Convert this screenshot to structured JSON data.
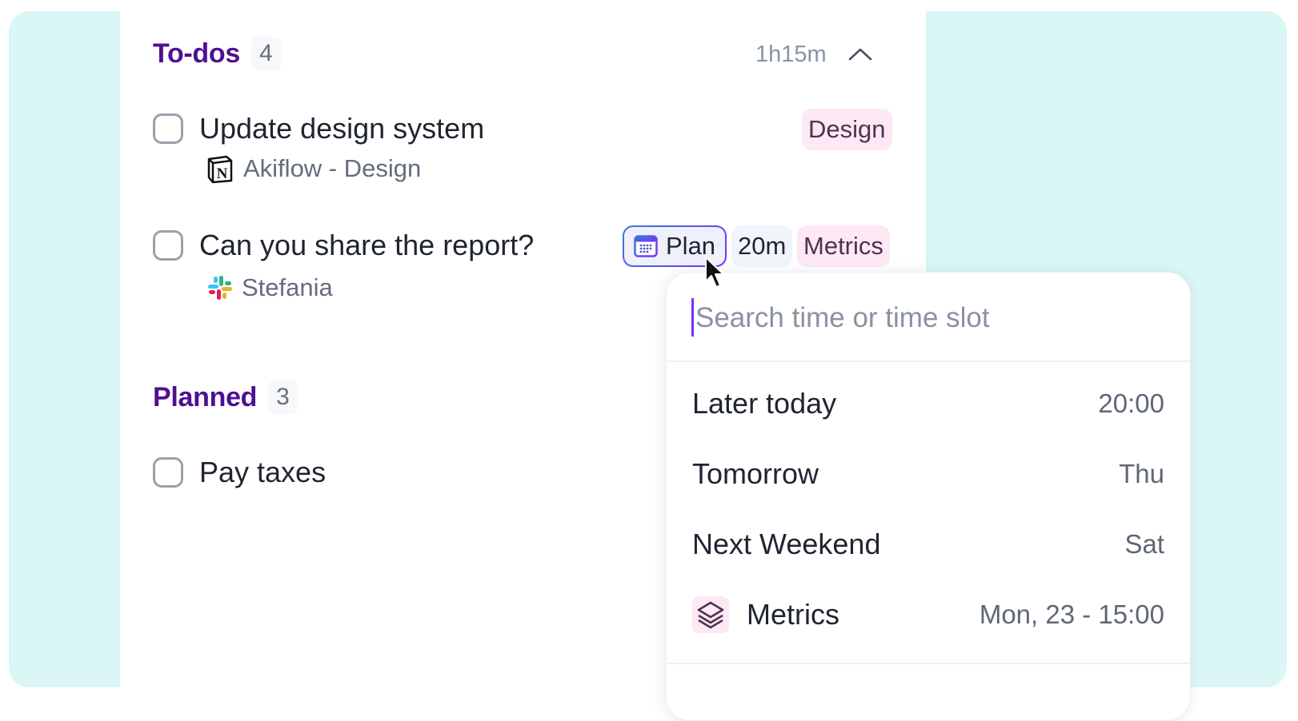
{
  "todos": {
    "title": "To-dos",
    "count": "4",
    "total_duration": "1h15m",
    "collapse_icon": "chevron-up-icon",
    "tasks": [
      {
        "title": "Update design system",
        "source_icon": "notion-icon",
        "source": "Akiflow - Design",
        "tag": "Design"
      },
      {
        "title": "Can you share the report?",
        "source_icon": "slack-icon",
        "source": "Stefania",
        "plan_label": "Plan",
        "duration": "20m",
        "tag": "Metrics"
      }
    ]
  },
  "planned": {
    "title": "Planned",
    "count": "3",
    "tasks": [
      {
        "title": "Pay taxes"
      }
    ]
  },
  "plan_popover": {
    "search_placeholder": "Search time or time slot",
    "search_value": "",
    "options": [
      {
        "label": "Later today",
        "value": "20:00"
      },
      {
        "label": "Tomorrow",
        "value": "Thu"
      },
      {
        "label": "Next Weekend",
        "value": "Sat"
      },
      {
        "label": "Metrics",
        "value": "Mon, 23 - 15:00",
        "icon": "layers-icon"
      }
    ]
  },
  "colors": {
    "accent": "#4f0f93",
    "background": "#daf6f5",
    "tag_pink": "#fde8f4",
    "plan_gradient_start": "#3a7bd5",
    "plan_gradient_end": "#7b2ff7"
  }
}
